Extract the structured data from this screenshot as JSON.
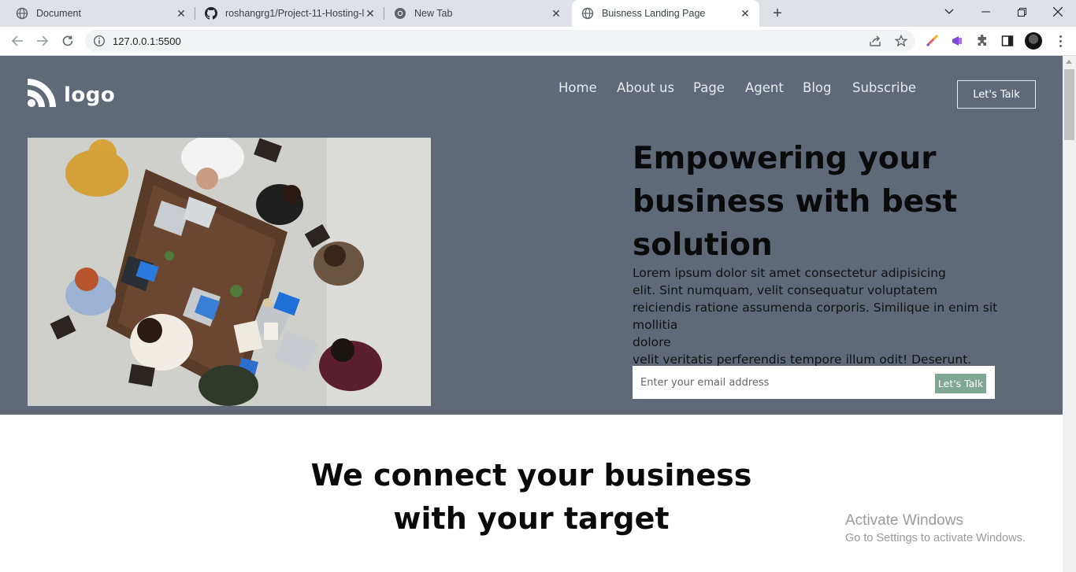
{
  "browser": {
    "tabs": [
      {
        "title": "Document",
        "icon": "globe-icon",
        "active": false
      },
      {
        "title": "roshangrg1/Project-11-Hosting-l",
        "icon": "github-icon",
        "active": false
      },
      {
        "title": "New Tab",
        "icon": "chrome-icon",
        "active": false
      },
      {
        "title": "Buisness Landing Page",
        "icon": "globe-icon",
        "active": true
      }
    ],
    "url": "127.0.0.1:5500"
  },
  "site": {
    "logo_text": "logo",
    "nav": [
      "Home",
      "About us",
      "Page",
      "Agent",
      "Blog",
      "Subscribe"
    ],
    "cta_label": "Let's Talk",
    "hero": {
      "headline_lines": [
        "Empowering your",
        "business with best",
        "solution"
      ],
      "paragraph_lines": [
        "Lorem ipsum dolor sit amet consectetur adipisicing",
        "elit. Sint numquam, velit consequatur voluptatem",
        "reiciendis ratione assumenda corporis. Similique in enim sit mollitia",
        "dolore",
        "velit veritatis perferendis tempore illum odit! Deserunt."
      ],
      "email_placeholder": "Enter your email address",
      "submit_label": "Let's Talk"
    },
    "section2": {
      "title_lines": [
        "We connect your business",
        "with your target"
      ]
    },
    "colors": {
      "hero_bg": "#5f6978",
      "submit_bg": "#7fa894"
    }
  },
  "os_watermark": {
    "line1": "Activate Windows",
    "line2": "Go to Settings to activate Windows."
  }
}
